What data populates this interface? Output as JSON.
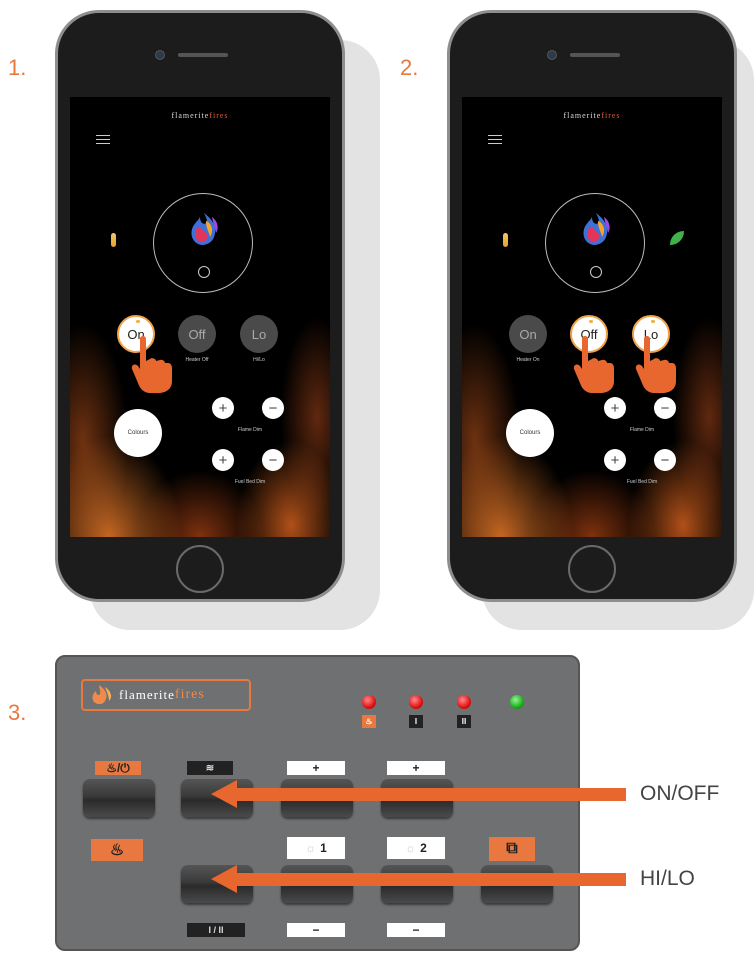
{
  "steps": [
    "1.",
    "2.",
    "3."
  ],
  "app": {
    "brand_a": "flamerite",
    "brand_b": "fires"
  },
  "phone1": {
    "buttons": [
      {
        "label": "On",
        "state": "active"
      },
      {
        "label": "Off",
        "state": "inactive"
      },
      {
        "label": "Lo",
        "state": "inactive"
      }
    ],
    "sublabels": [
      "Heater Off",
      "Hi/Lo"
    ],
    "colours_label": "Colours",
    "flame_dim": "Flame Dim",
    "fuel_bed_dim": "Fuel Bed Dim",
    "plus": "+",
    "minus": "−"
  },
  "phone2": {
    "buttons": [
      {
        "label": "On",
        "state": "inactive"
      },
      {
        "label": "Off",
        "state": "active"
      },
      {
        "label": "Lo",
        "state": "active"
      }
    ],
    "sublabels": [
      "Heater On"
    ],
    "colours_label": "Colours",
    "flame_dim": "Flame Dim",
    "fuel_bed_dim": "Fuel Bed Dim",
    "plus": "+",
    "minus": "−"
  },
  "panel": {
    "logo_a": "flamerite",
    "logo_b": "fires",
    "led_labels": [
      "I",
      "II"
    ],
    "power_tag": "/",
    "plus": "+",
    "minus": "−",
    "light1": "1",
    "light2": "2",
    "hilo_tag": "I / II"
  },
  "arrows": {
    "onoff": "ON/OFF",
    "hilo": "HI/LO"
  },
  "colors": {
    "accent": "#e8783f",
    "led_red": "#e01212",
    "led_green": "#18b018"
  }
}
